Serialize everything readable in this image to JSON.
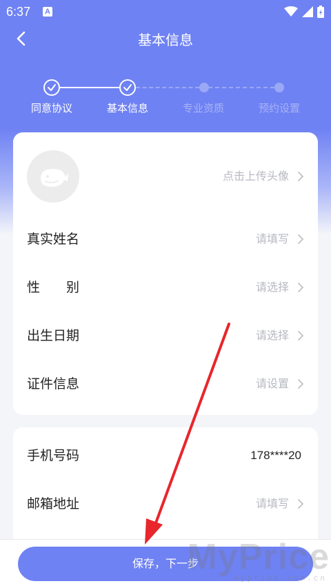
{
  "status_bar": {
    "time": "6:37",
    "notif_letter": "A"
  },
  "header": {
    "title": "基本信息"
  },
  "steps": [
    {
      "label": "同意协议",
      "state": "done"
    },
    {
      "label": "基本信息",
      "state": "done"
    },
    {
      "label": "专业资质",
      "state": "todo"
    },
    {
      "label": "预约设置",
      "state": "todo"
    }
  ],
  "basic_card": {
    "avatar_hint": "点击上传头像",
    "rows": [
      {
        "label": "真实姓名",
        "value": "请填写"
      },
      {
        "label": "性　　别",
        "value": "请选择"
      },
      {
        "label": "出生日期",
        "value": "请选择"
      },
      {
        "label": "证件信息",
        "value": "请设置"
      }
    ]
  },
  "contact_card": {
    "rows": [
      {
        "label": "手机号码",
        "value": "178****20"
      },
      {
        "label": "邮箱地址",
        "value": "请填写"
      }
    ]
  },
  "footer": {
    "save_label": "保存，下一步"
  },
  "watermark": {
    "text": "MyPrice",
    "sub": "myprice.com.cn"
  },
  "colors": {
    "brand": "#6f82f3",
    "annotation_arrow": "#e8262b"
  }
}
